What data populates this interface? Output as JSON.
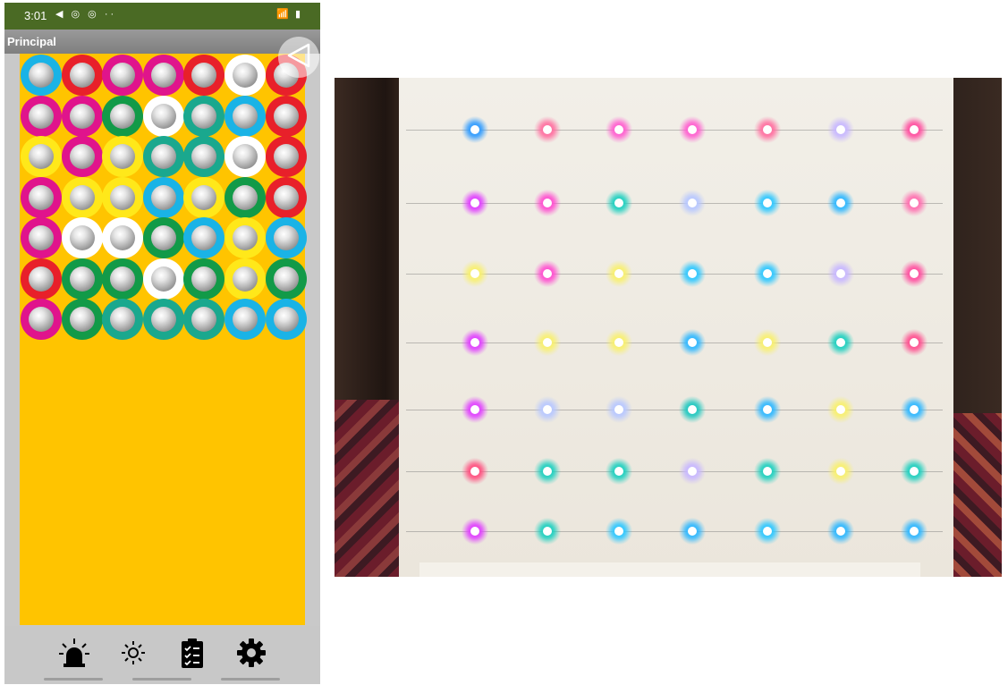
{
  "status_bar": {
    "time": "3:01",
    "left_icons": "◀ ◎ ◎ ··",
    "right_icons": "📶 ▮"
  },
  "title_bar": {
    "title": "Principal"
  },
  "colors": {
    "status_bar": "#4a6a24",
    "grid_background": "#ffc400",
    "ring_blue": "#1ab3e6",
    "ring_red": "#e8202a",
    "ring_magenta": "#e0148c",
    "ring_green": "#129a48",
    "ring_teal": "#1aa88e",
    "ring_yellow": "#ffe81a",
    "ring_white": "#ffffff"
  },
  "led_grid": [
    [
      "blue",
      "red",
      "magenta",
      "magenta",
      "red",
      "white",
      "red"
    ],
    [
      "magenta",
      "magenta",
      "green",
      "white",
      "teal",
      "blue",
      "red"
    ],
    [
      "yellow",
      "magenta",
      "yellow",
      "teal",
      "teal",
      "white",
      "red"
    ],
    [
      "magenta",
      "yellow",
      "yellow",
      "blue",
      "yellow",
      "green",
      "red"
    ],
    [
      "magenta",
      "white",
      "white",
      "green",
      "blue",
      "yellow",
      "blue"
    ],
    [
      "red",
      "green",
      "green",
      "white",
      "green",
      "yellow",
      "green"
    ],
    [
      "magenta",
      "green",
      "teal",
      "teal",
      "teal",
      "blue",
      "blue"
    ]
  ],
  "bottom_nav": {
    "items": [
      {
        "name": "alarm-light-icon"
      },
      {
        "name": "brightness-icon"
      },
      {
        "name": "clipboard-check-icon"
      },
      {
        "name": "settings-gear-icon"
      }
    ]
  },
  "photo": {
    "led_colors": [
      [
        "#2f9bff",
        "#ff6fa0",
        "#ff5fd0",
        "#ff5fd0",
        "#ff6fa0",
        "#c8b8ff",
        "#ff4fa0"
      ],
      [
        "#e040ff",
        "#ff50d0",
        "#20d0c0",
        "#b8c8ff",
        "#30c8ff",
        "#30b8ff",
        "#ff6fb0"
      ],
      [
        "#f8f070",
        "#ff50d0",
        "#f8f070",
        "#30c8ff",
        "#30c8ff",
        "#c8b8ff",
        "#ff50a0"
      ],
      [
        "#e040ff",
        "#f8f070",
        "#f8f070",
        "#30b8ff",
        "#f8f070",
        "#20d0c0",
        "#ff5090"
      ],
      [
        "#e040ff",
        "#b8c8ff",
        "#b8c8ff",
        "#20c8c0",
        "#30b8ff",
        "#f8f070",
        "#30b8ff"
      ],
      [
        "#ff5080",
        "#20d0c0",
        "#20d0c0",
        "#c8b8ff",
        "#20d0c0",
        "#f8f070",
        "#20d0c0"
      ],
      [
        "#e040ff",
        "#20d0c0",
        "#30c8ff",
        "#30b8ff",
        "#30c8ff",
        "#30b8ff",
        "#30b8ff"
      ]
    ]
  }
}
